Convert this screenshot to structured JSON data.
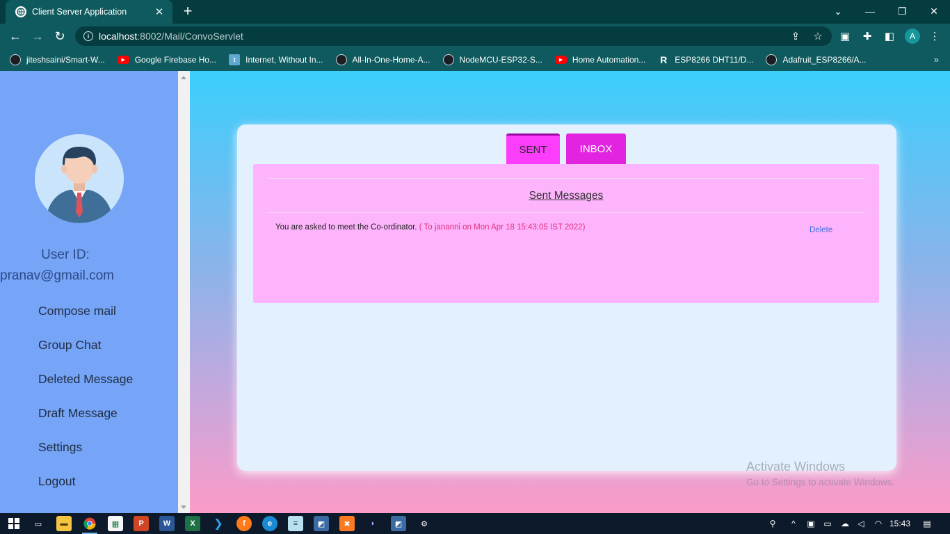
{
  "browser": {
    "tab_title": "Client Server Application",
    "tab_close": "✕",
    "new_tab": "+",
    "url_host": "localhost",
    "url_rest": ":8002/Mail/ConvoServlet",
    "profile_initial": "A",
    "bookmarks": [
      {
        "label": "jiteshsaini/Smart-W...",
        "icon": "github-icon"
      },
      {
        "label": "Google Firebase Ho...",
        "icon": "youtube-icon"
      },
      {
        "label": "Internet, Without In...",
        "icon": "telegram-icon"
      },
      {
        "label": "All-In-One-Home-A...",
        "icon": "github-icon"
      },
      {
        "label": "NodeMCU-ESP32-S...",
        "icon": "github-icon"
      },
      {
        "label": "Home Automation...",
        "icon": "youtube-icon"
      },
      {
        "label": "ESP8266 DHT11/D...",
        "icon": "r-icon"
      },
      {
        "label": "Adafruit_ESP8266/A...",
        "icon": "github-icon"
      }
    ],
    "bookmarks_more": "»"
  },
  "sidebar": {
    "user_id_label": "User ID:",
    "user_email": "pranav@gmail.com",
    "menu": [
      "Compose mail",
      "Group Chat",
      "Deleted Message",
      "Draft Message",
      "Settings",
      "Logout"
    ]
  },
  "main": {
    "tabs": {
      "sent": "SENT",
      "inbox": "INBOX"
    },
    "panel_title": "Sent Messages",
    "message": {
      "text": "You are asked to meet the Co-ordinator.",
      "meta": " ( To jananni on Mon Apr 18 15:43:05 IST 2022)",
      "delete_label": "Delete"
    }
  },
  "watermark": {
    "line1": "Activate Windows",
    "line2": "Go to Settings to activate Windows."
  },
  "taskbar": {
    "clock": "15:43"
  },
  "colors": {
    "sidebar": "#76a4f6",
    "tab_sent": "#fc3dfc",
    "tab_inbox": "#e223e0",
    "panel": "#fdb4fc",
    "chrome": "#0e5a5e"
  }
}
